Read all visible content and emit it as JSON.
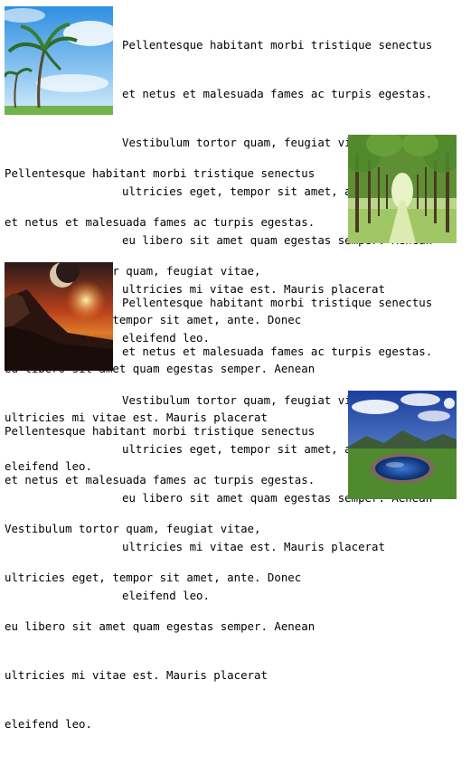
{
  "articles": [
    {
      "image_side": "left",
      "image": "palm-tree-sky",
      "lines": [
        "Pellentesque habitant morbi tristique senectus",
        "et netus et malesuada fames ac turpis egestas.",
        "Vestibulum tortor quam, feugiat vitae,",
        "ultricies eget, tempor sit amet, ante. Donec",
        "eu libero sit amet quam egestas semper. Aenean",
        "ultricies mi vitae est. Mauris placerat",
        "eleifend leo."
      ]
    },
    {
      "image_side": "right",
      "image": "tree-lined-path",
      "lines": [
        "Pellentesque habitant morbi tristique senectus",
        "et netus et malesuada fames ac turpis egestas.",
        "Vestibulum tortor quam, feugiat vitae,",
        "ultricies eget, tempor sit amet, ante. Donec",
        "eu libero sit amet quam egestas semper. Aenean",
        "ultricies mi vitae est. Mauris placerat",
        "eleifend leo."
      ]
    },
    {
      "image_side": "left",
      "image": "planet-sunset-landscape",
      "lines": [
        "Pellentesque habitant morbi tristique senectus",
        "et netus et malesuada fames ac turpis egestas.",
        "Vestibulum tortor quam, feugiat vitae,",
        "ultricies eget, tempor sit amet, ante. Donec",
        "eu libero sit amet quam egestas semper. Aenean",
        "ultricies mi vitae est. Mauris placerat",
        "eleifend leo."
      ]
    },
    {
      "image_side": "right",
      "image": "mountain-lake",
      "lines": [
        "Pellentesque habitant morbi tristique senectus",
        "et netus et malesuada fames ac turpis egestas.",
        "Vestibulum tortor quam, feugiat vitae,",
        "ultricies eget, tempor sit amet, ante. Donec",
        "eu libero sit amet quam egestas semper. Aenean",
        "ultricies mi vitae est. Mauris placerat",
        "eleifend leo."
      ]
    }
  ]
}
